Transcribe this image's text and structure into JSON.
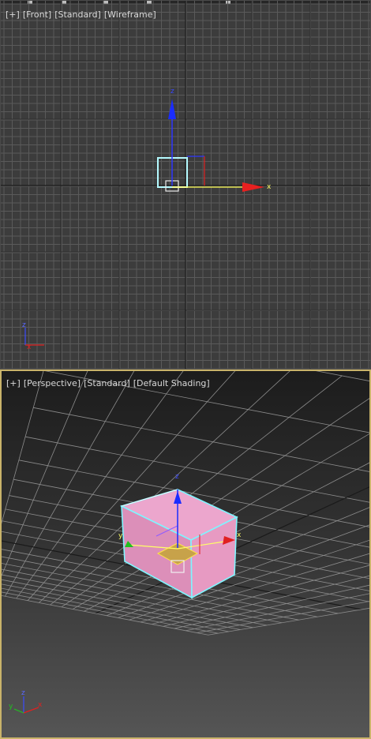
{
  "front_viewport": {
    "labels": [
      "[+]",
      "[Front]",
      "[Standard]",
      "[Wireframe]"
    ],
    "axes": {
      "x": "x",
      "z": "z"
    }
  },
  "perspective_viewport": {
    "labels": [
      "[+]",
      "[Perspective]",
      "[Standard]",
      "[Default Shading]"
    ],
    "axes": {
      "x": "x",
      "y": "y",
      "z": "z"
    }
  },
  "colors": {
    "active_border": "#c9b36a",
    "selection": "#7ff5ff",
    "box_fill": "#e59ac2",
    "axis_x": "#e02020",
    "axis_y": "#20c020",
    "axis_z": "#2020e0",
    "plane_highlight": "#ffe14a"
  }
}
